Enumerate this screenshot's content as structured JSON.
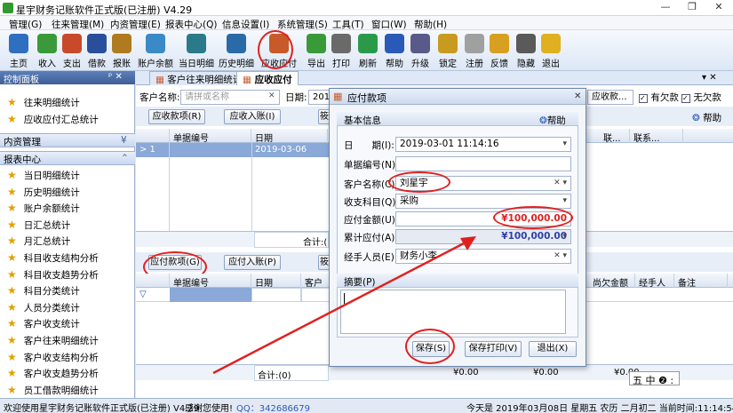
{
  "window": {
    "title": "星宇财务记账软件正式版(已注册) V4.29",
    "min": "—",
    "max": "❐",
    "close": "✕"
  },
  "menu": [
    "管理(G)",
    "往来管理(M)",
    "内资管理(E)",
    "报表中心(Q)",
    "信息设置(I)",
    "系统管理(S)",
    "工具(T)",
    "窗口(W)",
    "帮助(H)"
  ],
  "toolbar": [
    {
      "label": "主页",
      "icon": "home-icon",
      "color": "#2f6fbf"
    },
    {
      "label": "收入",
      "icon": "income-icon",
      "color": "#3a9a3a"
    },
    {
      "label": "支出",
      "icon": "expense-icon",
      "color": "#c84a2a"
    },
    {
      "label": "借款",
      "icon": "person-icon",
      "color": "#2a4f9a"
    },
    {
      "label": "报账",
      "icon": "books-icon",
      "color": "#b07a20"
    },
    {
      "label": "账户余额",
      "icon": "pie-icon",
      "color": "#3a8ac8"
    },
    {
      "label": "当日明细",
      "icon": "calendar-icon",
      "color": "#2a7a8a"
    },
    {
      "label": "历史明细",
      "icon": "history-icon",
      "color": "#2a6aa8"
    },
    {
      "label": "应收应付",
      "icon": "payable-icon",
      "color": "#c85a2a"
    },
    {
      "label": "导出",
      "icon": "export-icon",
      "color": "#3a9a3a"
    },
    {
      "label": "打印",
      "icon": "print-icon",
      "color": "#6a6a6a"
    },
    {
      "label": "刷新",
      "icon": "refresh-icon",
      "color": "#2a9a4a"
    },
    {
      "label": "帮助",
      "icon": "help-icon",
      "color": "#2a5ab8"
    },
    {
      "label": "升级",
      "icon": "upgrade-icon",
      "color": "#5a5a8a"
    },
    {
      "label": "锁定",
      "icon": "lock-icon",
      "color": "#c89a20"
    },
    {
      "label": "注册",
      "icon": "register-icon",
      "color": "#a0a0a0"
    },
    {
      "label": "反馈",
      "icon": "feedback-icon",
      "color": "#d8a020"
    },
    {
      "label": "隐藏",
      "icon": "hide-icon",
      "color": "#5a5a5a"
    },
    {
      "label": "退出",
      "icon": "exit-icon",
      "color": "#e0b020"
    }
  ],
  "leftpane": {
    "title": "控制面板",
    "pin": "ᵖ ✕",
    "top_items": [
      "往来明细统计",
      "应收应付汇总统计"
    ],
    "sections": [
      {
        "title": "内资管理",
        "chev": "¥"
      },
      {
        "title": "报表中心",
        "chev": "⌃"
      }
    ],
    "report_items": [
      "当日明细统计",
      "历史明细统计",
      "账户余额统计",
      "日汇总统计",
      "月汇总统计",
      "科目收支结构分析",
      "科目收支趋势分析",
      "科目分类统计",
      "人员分类统计",
      "客户收支统计",
      "客户往来明细统计",
      "客户收支结构分析",
      "客户收支趋势分析",
      "员工借款明细统计"
    ]
  },
  "tabs": [
    "客户往来明细统计",
    "应收应付"
  ],
  "pane_close": "▾ ✕",
  "filter": {
    "customer_label": "客户名称:",
    "customer_placeholder": "请拼或名称",
    "date_label": "日期:",
    "date_value": "201",
    "status_value": "应收款...",
    "chk_owed": "有欠款",
    "chk_none": "无欠款"
  },
  "receivable": {
    "btn_items": "应收款项(R)",
    "btn_in": "应收入账(I)",
    "btn_extra": "筱",
    "help": "帮助",
    "columns": [
      "单据编号",
      "日期"
    ],
    "columns_right": [
      "联...",
      "联系..."
    ],
    "row_marker": "> 1",
    "row_date": "2019-03-06",
    "total": "合计:("
  },
  "payable": {
    "btn_items": "应付款项(G)",
    "btn_in": "应付入账(P)",
    "btn_extra": "筱",
    "columns": [
      "单据编号",
      "日期",
      "客户名"
    ],
    "columns_right": [
      "尚欠金额",
      "经手人",
      "备注"
    ],
    "filter_marker": "▽",
    "total": "合计:(0)",
    "sums": [
      "¥0.00",
      "¥0.00",
      "¥0.00"
    ]
  },
  "dialog": {
    "title": "应付款项",
    "section": "基本信息",
    "help": "帮助",
    "fields": [
      {
        "label": "日　　期(I):",
        "value": "2019-03-01 11:14:16",
        "ctl": "▾"
      },
      {
        "label": "单据编号(N):",
        "value": "",
        "ctl": ""
      },
      {
        "label": "客户名称(C):",
        "value": "刘星宇",
        "ctl": "✕ ▾"
      },
      {
        "label": "收支科目(Q):",
        "value": "采购",
        "ctl": "▾"
      },
      {
        "label": "应付金额(U):",
        "value": "¥100,000.00",
        "ctl": ""
      },
      {
        "label": "累计应付(A):",
        "value": "¥100,000.00",
        "ctl": "▾"
      },
      {
        "label": "经手人员(E):",
        "value": "财务小李",
        "ctl": "✕ ▾"
      }
    ],
    "memo_label": "摘要(P)",
    "btn_save": "保存(S)",
    "btn_save_print": "保存打印(V)",
    "btn_exit": "退出(X)",
    "close": "✕"
  },
  "ime": "五 中 ❷ :",
  "status": {
    "welcome": "欢迎使用星宇财务记账软件正式版(已注册) V4.29",
    "thanks": "感谢您使用!",
    "qq": "QQ：342686679",
    "today": "今天是 2019年03月08日 星期五 农历 二月初二 当前时间:11:14:54"
  },
  "colors": {
    "accent": "#2f5fa8",
    "circle": "#e02020",
    "amount": "#e02020"
  }
}
